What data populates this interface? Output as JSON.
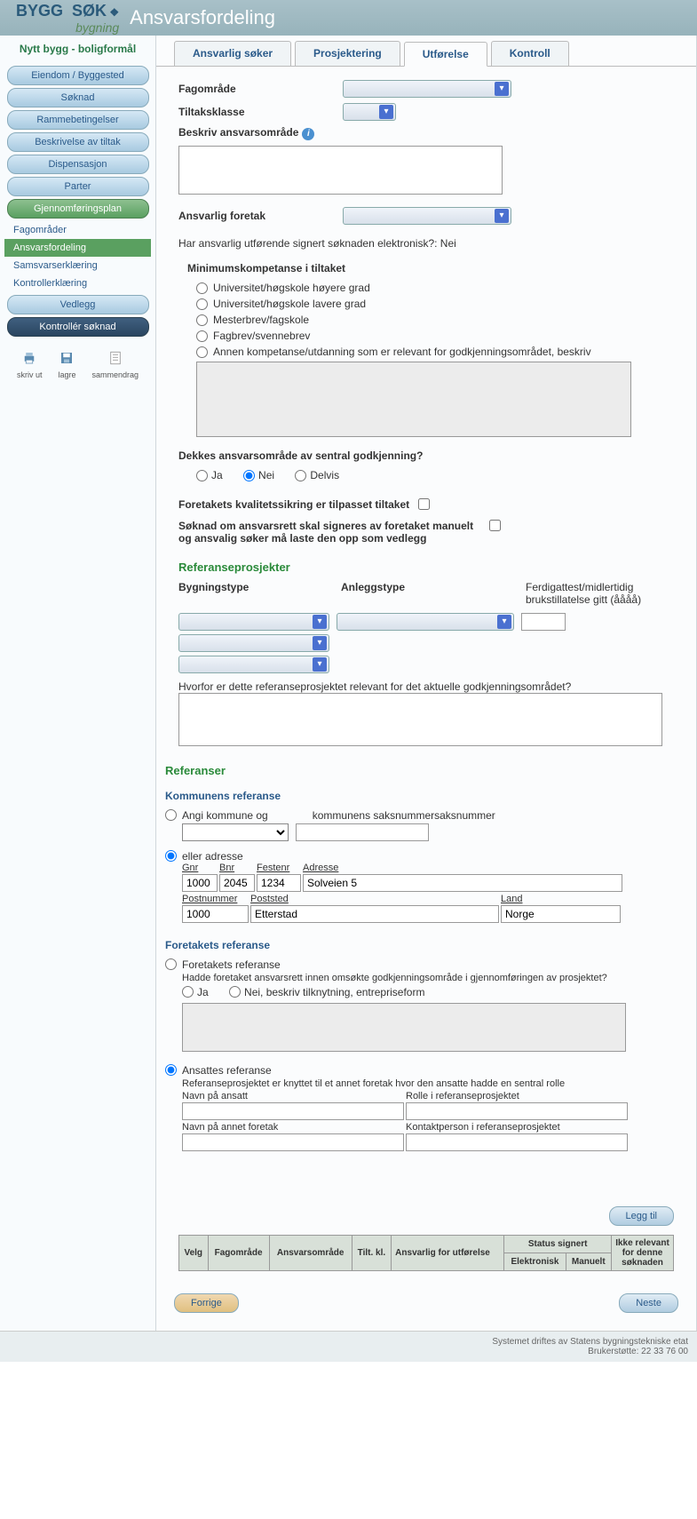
{
  "header": {
    "logo_main": "BYGG",
    "logo_light": "SØK",
    "logo_sub": "bygning",
    "page_title": "Ansvarsfordeling"
  },
  "sidebar": {
    "subtitle": "Nytt bygg - boligformål",
    "items": [
      {
        "label": "Eiendom / Byggested",
        "type": "btn"
      },
      {
        "label": "Søknad",
        "type": "btn"
      },
      {
        "label": "Rammebetingelser",
        "type": "btn"
      },
      {
        "label": "Beskrivelse av tiltak",
        "type": "btn"
      },
      {
        "label": "Dispensasjon",
        "type": "btn"
      },
      {
        "label": "Parter",
        "type": "btn"
      },
      {
        "label": "Gjennomføringsplan",
        "type": "green"
      },
      {
        "label": "Fagområder",
        "type": "link"
      },
      {
        "label": "Ansvarsfordeling",
        "type": "link-active"
      },
      {
        "label": "Samsvarserklæring",
        "type": "link"
      },
      {
        "label": "Kontrollerklæring",
        "type": "link"
      },
      {
        "label": "Vedlegg",
        "type": "btn"
      },
      {
        "label": "Kontrollér søknad",
        "type": "dark"
      }
    ],
    "tools": [
      {
        "label": "skriv ut",
        "icon": "print"
      },
      {
        "label": "lagre",
        "icon": "save"
      },
      {
        "label": "sammendrag",
        "icon": "summary"
      }
    ]
  },
  "tabs": [
    "Ansvarlig søker",
    "Prosjektering",
    "Utførelse",
    "Kontroll"
  ],
  "active_tab": 2,
  "form": {
    "fagomrade_label": "Fagområde",
    "tiltaksklasse_label": "Tiltaksklasse",
    "beskriv_label": "Beskriv ansvarsområde",
    "ansvarlig_foretak_label": "Ansvarlig foretak",
    "signert_text": "Har ansvarlig utførende signert søknaden elektronisk?: Nei",
    "min_kompetanse_h": "Minimumskompetanse i tiltaket",
    "komp_options": [
      "Universitet/høgskole høyere grad",
      "Universitet/høgskole lavere grad",
      "Mesterbrev/fagskole",
      "Fagbrev/svennebrev",
      "Annen kompetanse/utdanning som er relevant for godkjenningsområdet, beskriv"
    ],
    "dekkes_label": "Dekkes ansvarsområde av sentral godkjenning?",
    "dekkes_options": [
      "Ja",
      "Nei",
      "Delvis"
    ],
    "dekkes_selected": 1,
    "kvalitet_label": "Foretakets kvalitetssikring er tilpasset tiltaket",
    "manuell_label": "Søknad om ansvarsrett skal signeres av foretaket manuelt og ansvalig søker må laste den opp som vedlegg",
    "ref_h": "Referanseprosjekter",
    "ref_cols": {
      "bygning": "Bygningstype",
      "anlegg": "Anleggstype",
      "ferdig": "Ferdigattest/midlertidig brukstillatelse gitt (åååå)"
    },
    "relevans_label": "Hvorfor er dette referanseprosjektet relevant for det aktuelle godkjenningsområdet?",
    "referanser_h": "Referanser",
    "kommune_h": "Kommunens referanse",
    "angi_kommune": "Angi kommune og",
    "saksnr_label": "kommunens saksnummersaksnummer",
    "eller_adresse": "eller adresse",
    "addr": {
      "gnr_l": "Gnr",
      "bnr_l": "Bnr",
      "festenr_l": "Festenr",
      "adresse_l": "Adresse",
      "postnr_l": "Postnummer",
      "poststed_l": "Poststed",
      "land_l": "Land",
      "gnr": "1000",
      "bnr": "2045",
      "festenr": "1234",
      "adresse": "Solveien 5",
      "postnr": "1000",
      "poststed": "Etterstad",
      "land": "Norge"
    },
    "foretak_h": "Foretakets referanse",
    "foretak_ref_label": "Foretakets referanse",
    "hadde_label": "Hadde foretaket ansvarsrett innen omsøkte godkjenningsområde i gjennomføringen av prosjektet?",
    "hadde_ja": "Ja",
    "hadde_nei": "Nei, beskriv tilknytning, entrepriseform",
    "ansatt_label": "Ansattes referanse",
    "ansatt_text": "Referanseprosjektet er knyttet til et annet foretak hvor den ansatte hadde en sentral rolle",
    "navn_ansatt": "Navn på ansatt",
    "rolle": "Rolle i referanseprosjektet",
    "navn_foretak": "Navn på annet foretak",
    "kontakt": "Kontaktperson i referanseprosjektet",
    "legg_til": "Legg til"
  },
  "table_headers": [
    "Velg",
    "Fagområde",
    "Ansvarsområde",
    "Tilt. kl.",
    "Ansvarlig for utførelse",
    "Status signert",
    "Elektronisk",
    "Manuelt",
    "Ikke relevant for denne søknaden"
  ],
  "buttons": {
    "forrige": "Forrige",
    "neste": "Neste"
  },
  "footer": {
    "line1": "Systemet driftes av Statens bygningstekniske etat",
    "line2": "Brukerstøtte: 22 33 76 00"
  }
}
